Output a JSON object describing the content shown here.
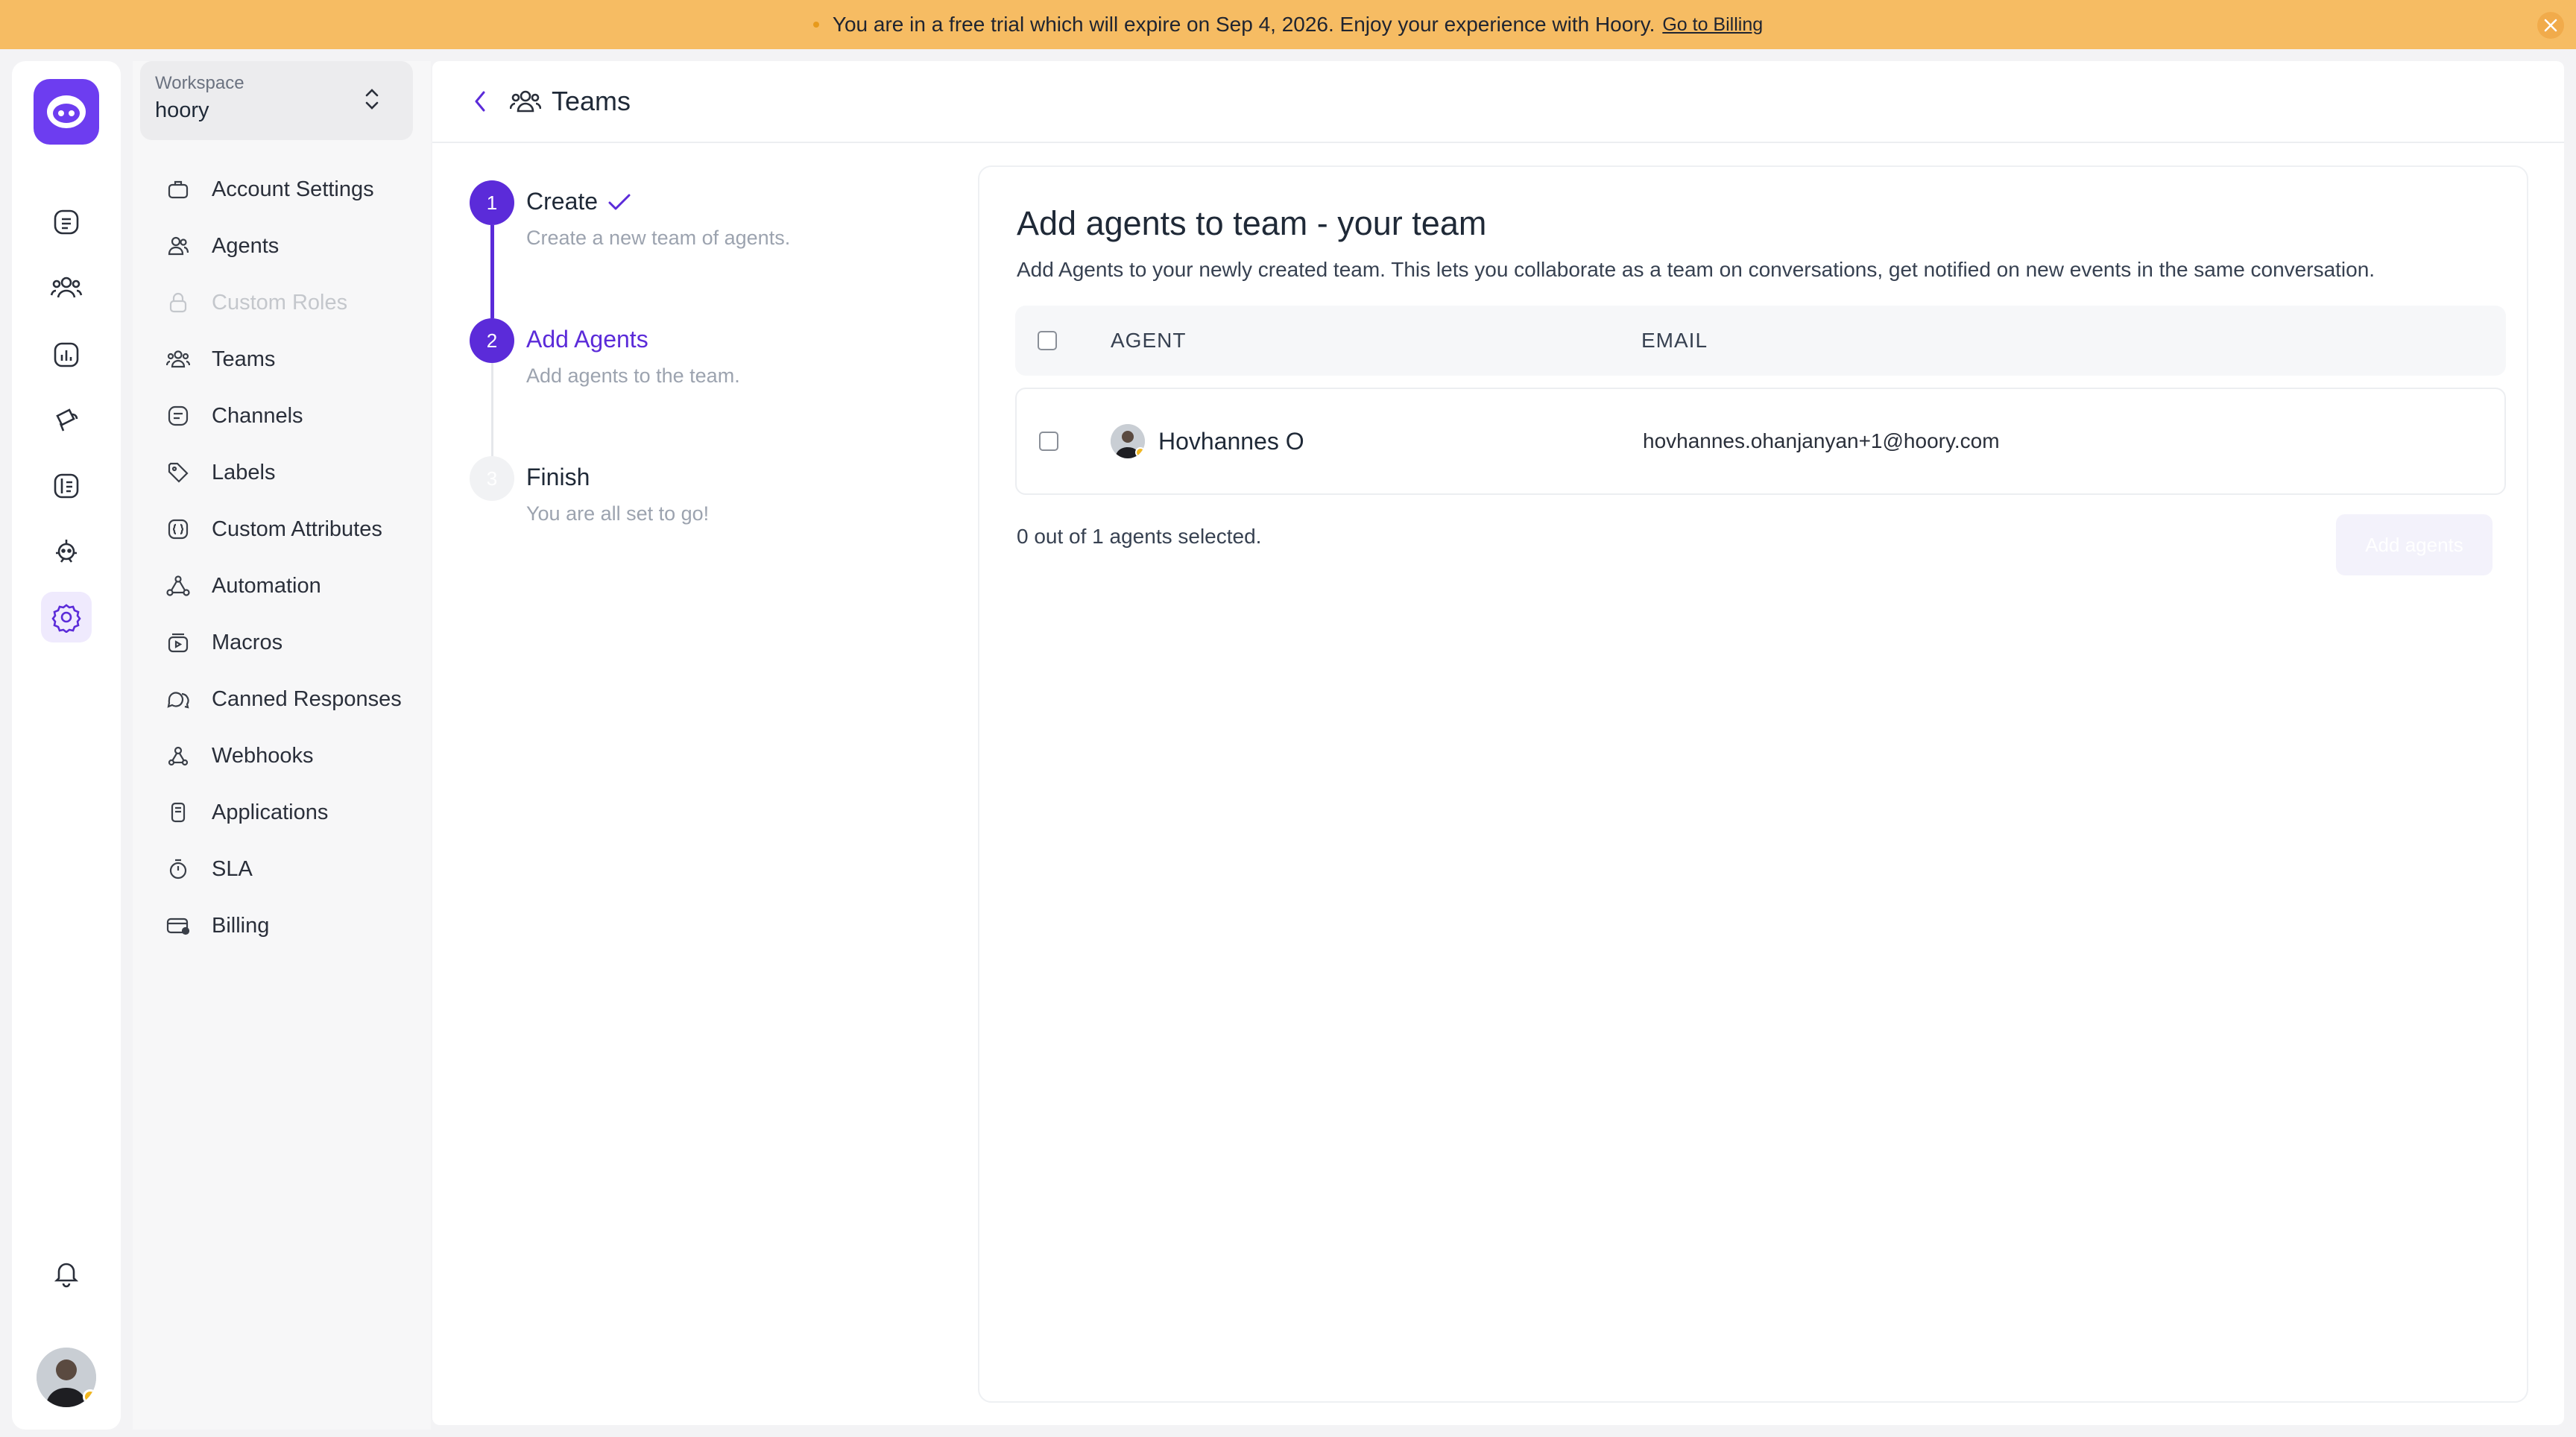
{
  "banner": {
    "message": "You are in a free trial which will expire on Sep 4, 2026. Enjoy your experience with Hoory.",
    "link": "Go to Billing",
    "background": "#f6bc63"
  },
  "rail": {
    "items": [
      {
        "icon": "conversations-icon"
      },
      {
        "icon": "contacts-icon"
      },
      {
        "icon": "reports-icon"
      },
      {
        "icon": "campaigns-icon"
      },
      {
        "icon": "help-center-icon"
      },
      {
        "icon": "bot-icon"
      },
      {
        "icon": "settings-icon",
        "active": true
      }
    ],
    "notifications_icon": "bell-icon"
  },
  "workspace": {
    "label": "Workspace",
    "name": "hoory"
  },
  "sidebar": {
    "items": [
      {
        "label": "Account Settings",
        "icon": "briefcase-icon"
      },
      {
        "label": "Agents",
        "icon": "people-icon"
      },
      {
        "label": "Custom Roles",
        "icon": "lock-icon",
        "disabled": true
      },
      {
        "label": "Teams",
        "icon": "people-team-icon"
      },
      {
        "label": "Channels",
        "icon": "channel-icon"
      },
      {
        "label": "Labels",
        "icon": "tag-icon"
      },
      {
        "label": "Custom Attributes",
        "icon": "attribute-icon"
      },
      {
        "label": "Automation",
        "icon": "automation-icon"
      },
      {
        "label": "Macros",
        "icon": "macro-icon"
      },
      {
        "label": "Canned Responses",
        "icon": "chat-multiple-icon"
      },
      {
        "label": "Webhooks",
        "icon": "webhook-icon"
      },
      {
        "label": "Applications",
        "icon": "app-icon"
      },
      {
        "label": "SLA",
        "icon": "timer-icon"
      },
      {
        "label": "Billing",
        "icon": "billing-icon"
      }
    ]
  },
  "header": {
    "title": "Teams"
  },
  "steps": [
    {
      "number": "1",
      "title": "Create",
      "description": "Create a new team of agents.",
      "state": "done"
    },
    {
      "number": "2",
      "title": "Add Agents",
      "description": "Add agents to the team.",
      "state": "active"
    },
    {
      "number": "3",
      "title": "Finish",
      "description": "You are all set to go!",
      "state": "pending"
    }
  ],
  "content": {
    "heading": "Add agents to team - your team",
    "description": "Add Agents to your newly created team. This lets you collaborate as a team on conversations, get notified on new events in the same conversation.",
    "columns": {
      "agent": "AGENT",
      "email": "EMAIL"
    },
    "agents": [
      {
        "name": "Hovhannes O",
        "email": "hovhannes.ohanjanyan+1@hoory.com",
        "selected": false
      }
    ],
    "selection_status": "0 out of 1 agents selected.",
    "submit_label": "Add agents"
  },
  "colors": {
    "accent": "#5b2bd9",
    "logo": "#6d3df0",
    "presence": "#f2b720"
  }
}
